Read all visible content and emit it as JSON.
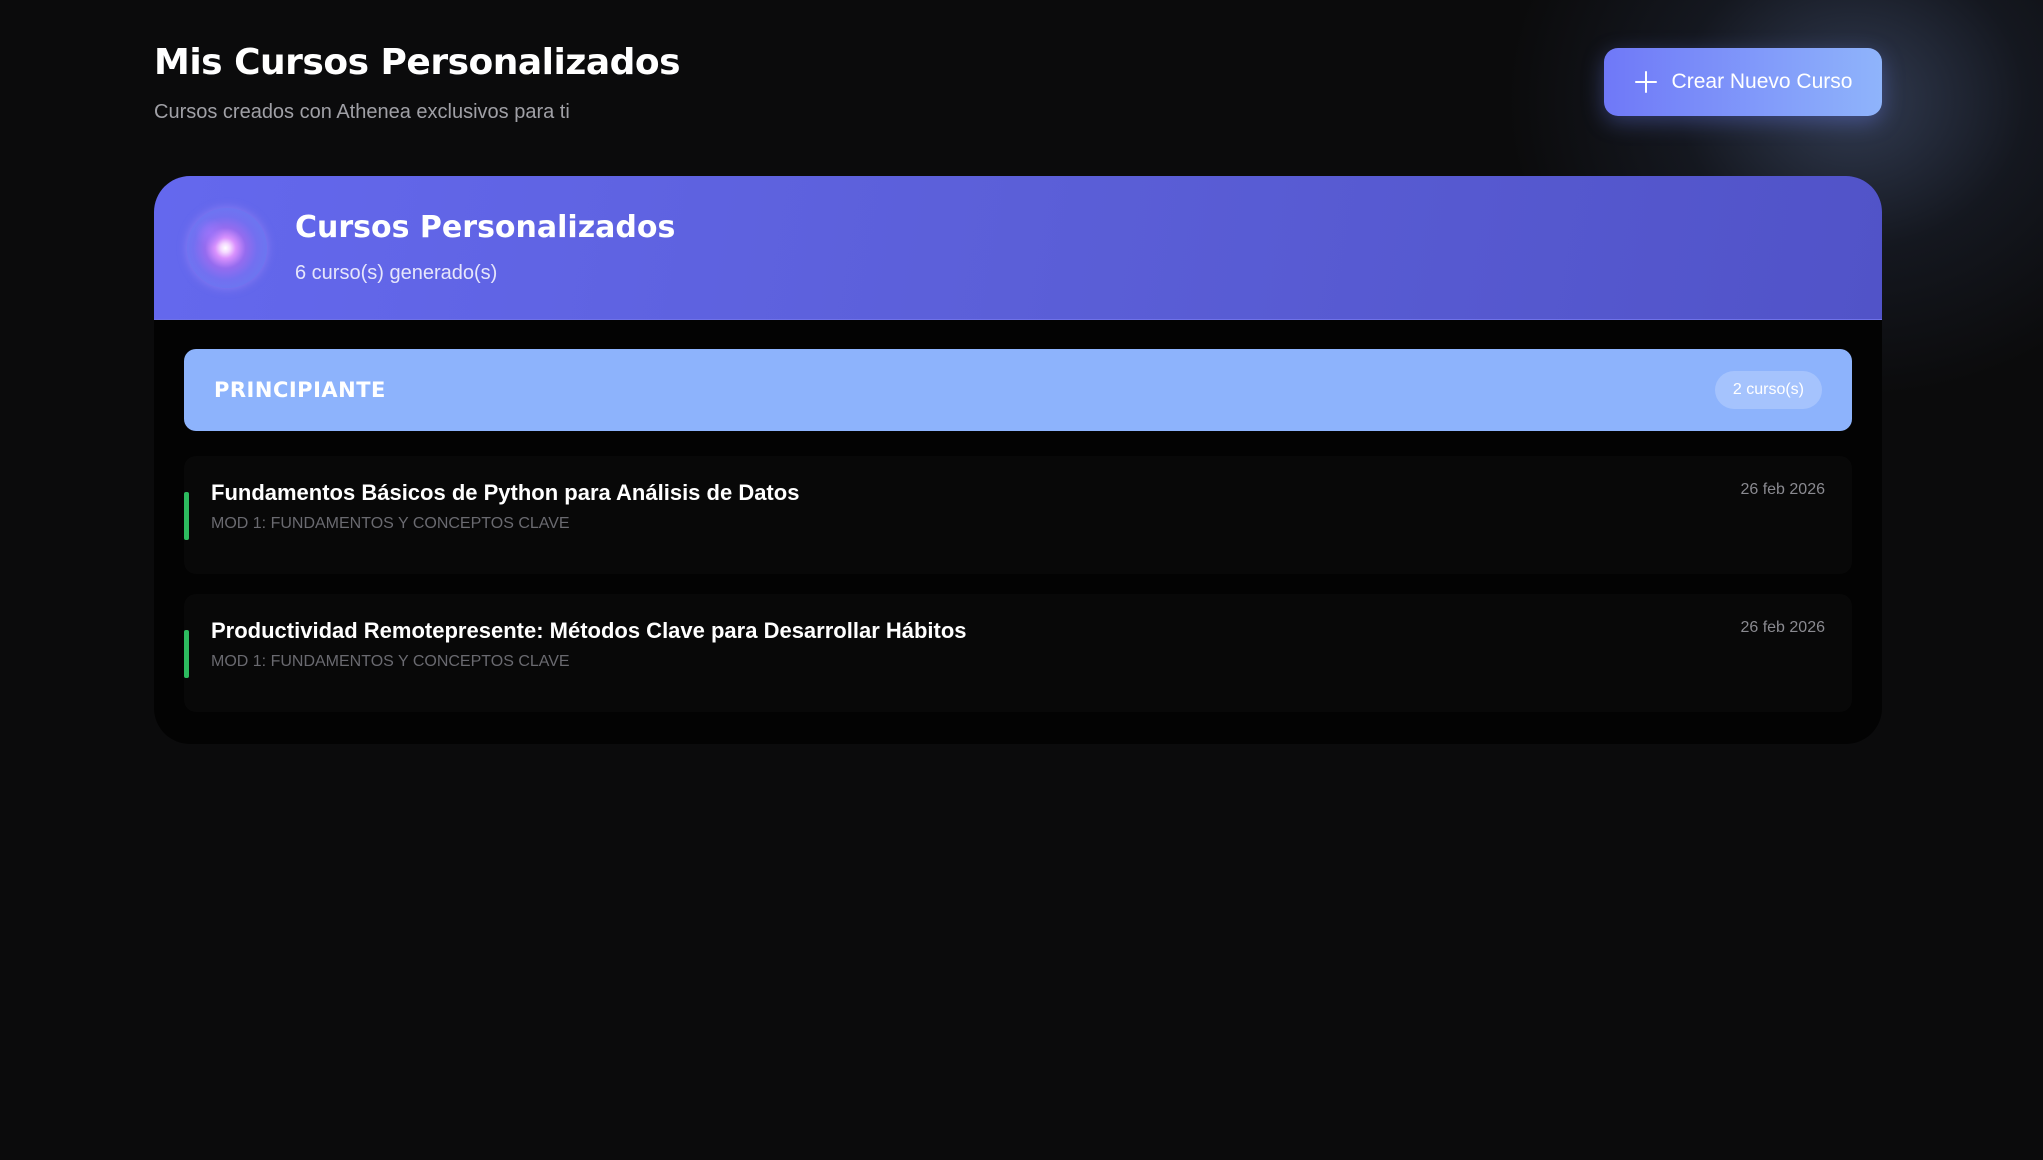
{
  "header": {
    "title": "Mis Cursos Personalizados",
    "subtitle": "Cursos creados con Athenea exclusivos para ti"
  },
  "create_button": {
    "label": "Crear Nuevo Curso",
    "icon": "plus-icon"
  },
  "card": {
    "icon": "orb-icon",
    "title": "Cursos Personalizados",
    "count": "6 curso(s) generado(s)",
    "colors": {
      "header_gradient_start": "#6468ee",
      "header_gradient_end": "#5153c8"
    }
  },
  "level_group": {
    "label": "PRINCIPIANTE",
    "badge": "2 curso(s)",
    "color": "#8db3fc"
  },
  "courses": [
    {
      "title": "Fundamentos Básicos de Python para Análisis de Datos",
      "module": "MOD 1: FUNDAMENTOS Y CONCEPTOS CLAVE",
      "date": "26 feb 2026",
      "accent_color": "#2dbb5f"
    },
    {
      "title": "Productividad Remotepresente: Métodos Clave para Desarrollar Hábitos",
      "module": "MOD 1: FUNDAMENTOS Y CONCEPTOS CLAVE",
      "date": "26 feb 2026",
      "accent_color": "#2dbb5f"
    }
  ]
}
